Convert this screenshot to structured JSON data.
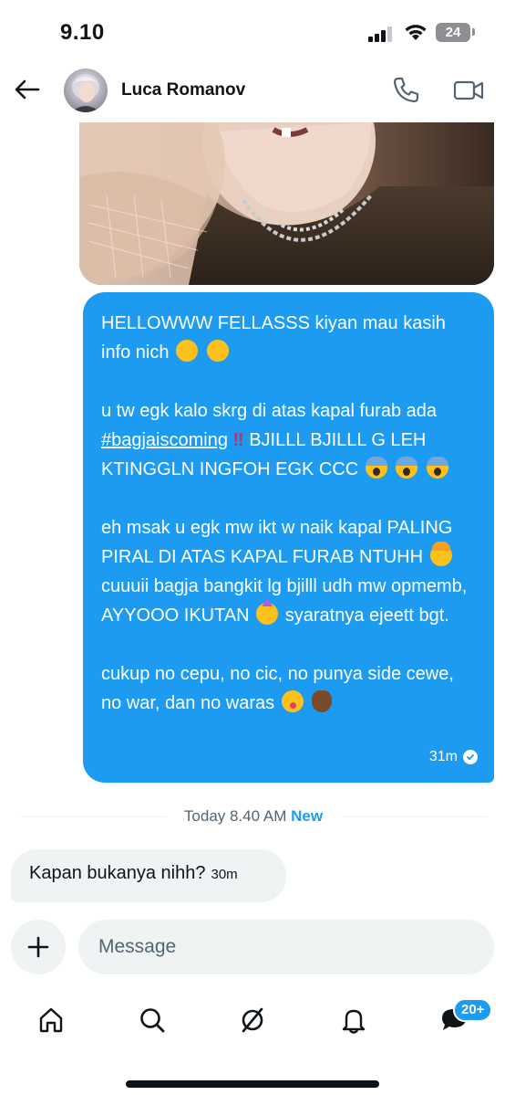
{
  "status_bar": {
    "time": "9.10",
    "battery": "24"
  },
  "header": {
    "contact_name": "Luca Romanov",
    "icons": [
      "back-arrow-icon",
      "phone-icon",
      "video-camera-icon"
    ]
  },
  "sent_message": {
    "paragraphs": [
      {
        "parts": [
          {
            "type": "text",
            "value": "HELLOWWW FELLASSS kiyan mau kasih info nich "
          },
          {
            "type": "emoji",
            "name": "smirk-emoji"
          },
          {
            "type": "text",
            "value": " "
          },
          {
            "type": "emoji",
            "name": "smirk-emoji"
          }
        ]
      },
      {
        "parts": [
          {
            "type": "text",
            "value": "u tw egk kalo skrg di atas kapal furab ada "
          },
          {
            "type": "hashtag",
            "value": "#bagjaiscoming"
          },
          {
            "type": "text",
            "value": " "
          },
          {
            "type": "emoji",
            "name": "double-exclamation-emoji"
          },
          {
            "type": "text",
            "value": " BJILLL BJILLL G LEH KTINGGLN INGFOH EGK CCC "
          },
          {
            "type": "emoji",
            "name": "screaming-face-emoji"
          },
          {
            "type": "text",
            "value": " "
          },
          {
            "type": "emoji",
            "name": "screaming-face-emoji"
          },
          {
            "type": "text",
            "value": " "
          },
          {
            "type": "emoji",
            "name": "screaming-face-emoji"
          }
        ]
      },
      {
        "parts": [
          {
            "type": "text",
            "value": "eh msak u egk mw ikt w naik kapal PALING PIRAL DI ATAS KAPAL FURAB NTUHH "
          },
          {
            "type": "emoji",
            "name": "exploding-head-emoji"
          },
          {
            "type": "text",
            "value": " cuuuii bagja bangkit lg bjilll udh mw opmemb, AYYOOO IKUTAN "
          },
          {
            "type": "emoji",
            "name": "partying-face-emoji"
          },
          {
            "type": "text",
            "value": " syaratnya ejeett bgt."
          }
        ]
      },
      {
        "parts": [
          {
            "type": "text",
            "value": "cukup no cepu, no cic, no punya side cewe, no war, dan no waras "
          },
          {
            "type": "emoji",
            "name": "winking-tongue-emoji"
          },
          {
            "type": "text",
            "value": " "
          },
          {
            "type": "emoji",
            "name": "call-me-hand-emoji"
          }
        ]
      }
    ],
    "time": "31m"
  },
  "divider": {
    "label": "Today 8.40 AM",
    "new_label": "New"
  },
  "received_message": {
    "text": "Kapan bukanya nihh?",
    "time": "30m"
  },
  "composer": {
    "placeholder": "Message"
  },
  "bottom_nav": {
    "items": [
      "home-icon",
      "search-icon",
      "grok-icon",
      "notifications-icon",
      "messages-icon"
    ],
    "messages_badge": "20+"
  },
  "colors": {
    "accent": "#1d9bf0",
    "received_bubble": "#eff3f4",
    "text_primary": "#0f1419",
    "text_secondary": "#536471"
  }
}
